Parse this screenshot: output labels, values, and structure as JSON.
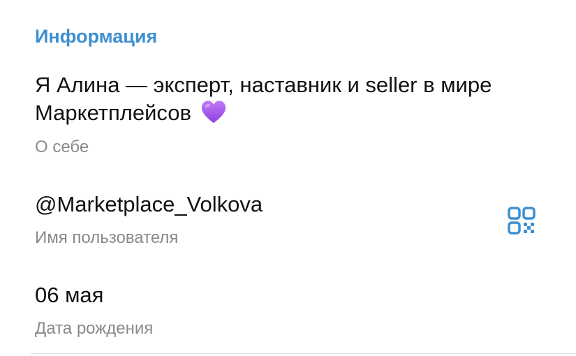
{
  "section": {
    "title": "Информация"
  },
  "bio": {
    "text": "Я Алина — эксперт, наставник и seller в мире Маркетплейсов",
    "emoji_icon": "purple-heart-icon",
    "caption": "О себе"
  },
  "username": {
    "value": "@Marketplace_Volkova",
    "caption": "Имя пользователя",
    "action_icon": "qr-code-icon"
  },
  "birthday": {
    "value": "06 мая",
    "caption": "Дата рождения"
  },
  "colors": {
    "accent": "#3d8fd1",
    "caption": "#8a8a8a",
    "heart": "#a14ee6"
  }
}
